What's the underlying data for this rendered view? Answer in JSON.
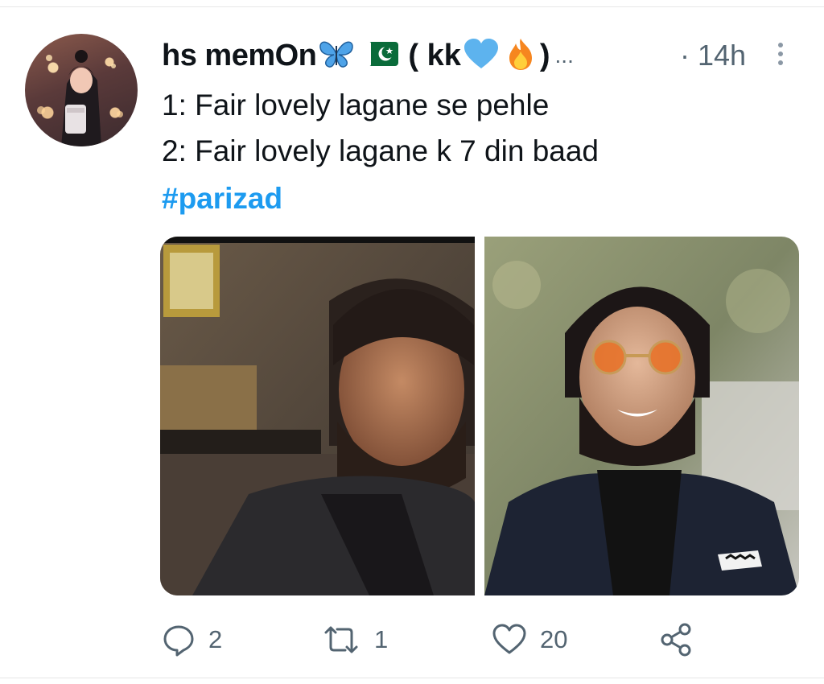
{
  "tweet": {
    "display_name": "hs memOn",
    "name_suffix_open": "( kk",
    "name_suffix_close": ")",
    "ellipsis": "...",
    "time": "· 14h",
    "lines": [
      "1: Fair lovely lagane se pehle",
      "2: Fair lovely lagane k 7 din baad"
    ],
    "hashtag": "#parizad",
    "icons": {
      "name_emojis": [
        "butterfly-emoji",
        "pakistan-flag-emoji",
        "blue-heart-emoji",
        "fire-emoji"
      ],
      "more": "more-options-icon"
    }
  },
  "actions": {
    "reply_count": "2",
    "retweet_count": "1",
    "like_count": "20",
    "icons": [
      "reply-icon",
      "retweet-icon",
      "like-icon",
      "share-icon"
    ]
  },
  "colors": {
    "text": "#0f1419",
    "secondary": "#536471",
    "hashtag": "#1d9bf0"
  }
}
